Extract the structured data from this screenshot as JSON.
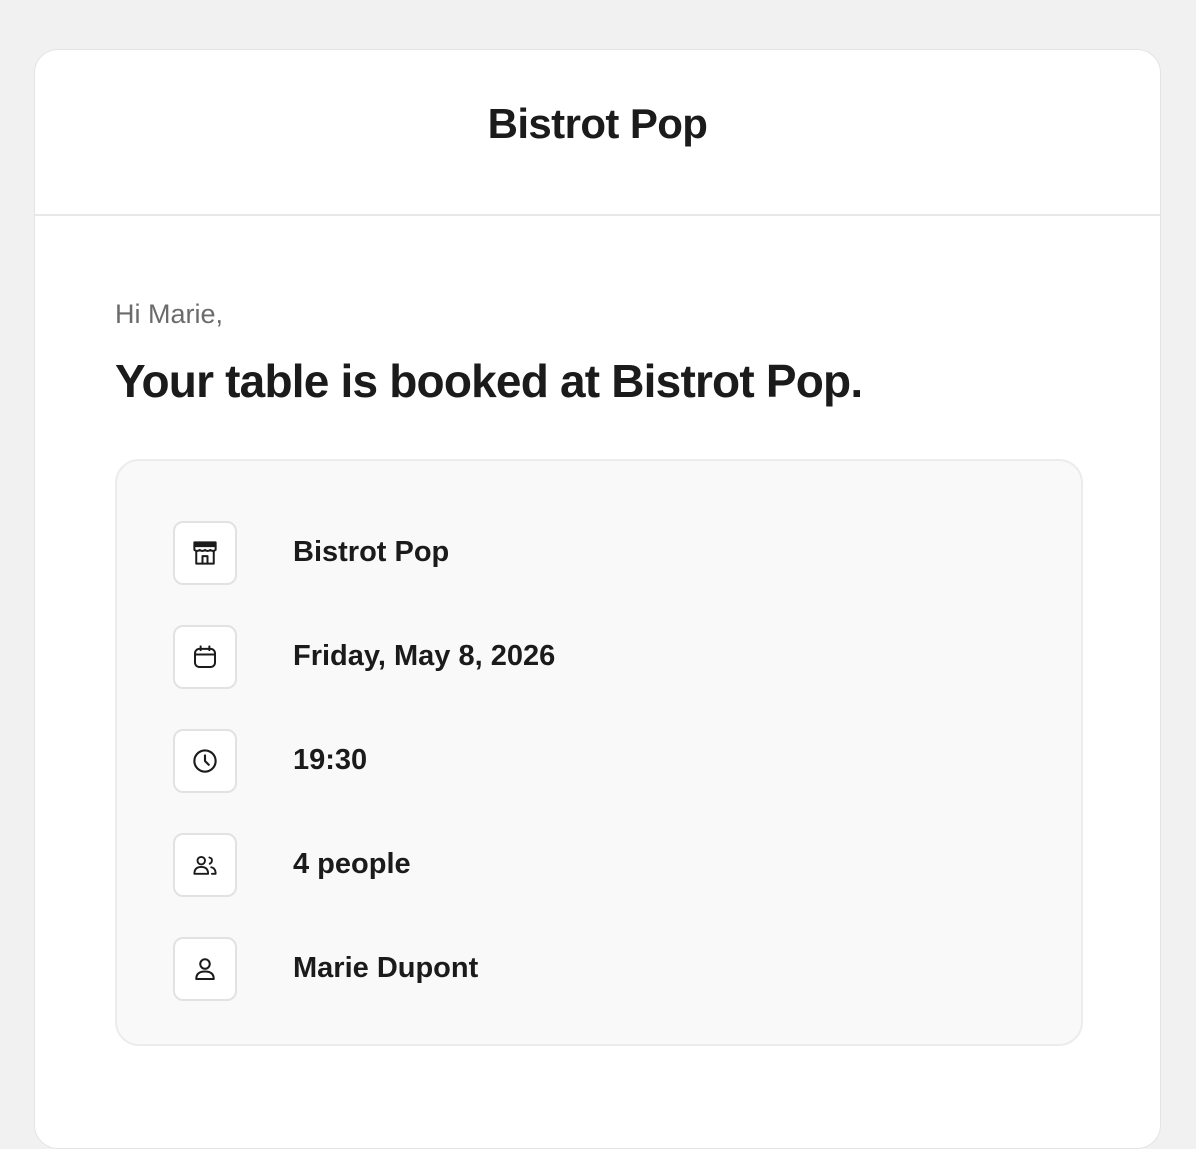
{
  "header": {
    "brand": "Bistrot Pop"
  },
  "message": {
    "greeting": "Hi Marie,",
    "headline": "Your table is booked at Bistrot Pop."
  },
  "details": [
    {
      "icon": "storefront-icon",
      "label": "Bistrot Pop"
    },
    {
      "icon": "calendar-icon",
      "label": "Friday, May 8, 2026"
    },
    {
      "icon": "clock-icon",
      "label": "19:30"
    },
    {
      "icon": "people-icon",
      "label": "4 people"
    },
    {
      "icon": "person-icon",
      "label": "Marie Dupont"
    }
  ],
  "colors": {
    "background": "#f1f1f1",
    "card": "#ffffff",
    "panel": "#f9f9f9",
    "text": "#1b1b1b",
    "muted": "#6b6b6b"
  }
}
